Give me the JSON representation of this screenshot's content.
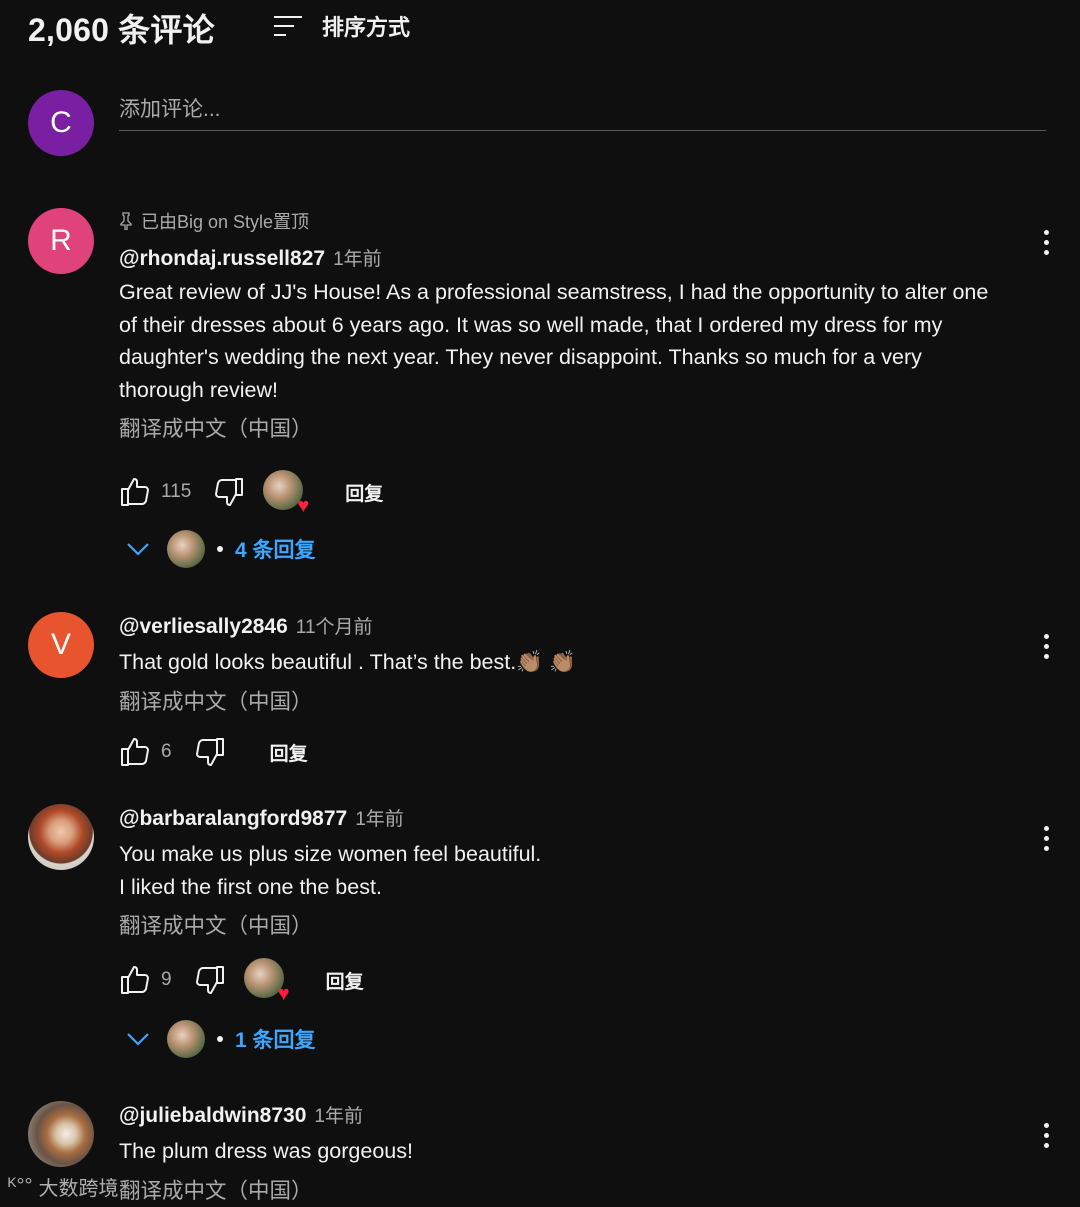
{
  "header": {
    "count": "2,060 条评论",
    "sort_label": "排序方式"
  },
  "add_comment": {
    "avatar_letter": "C",
    "placeholder": "添加评论...",
    "avatar_color": "#7b1fa2"
  },
  "comments": [
    {
      "pinned": "已由Big on Style置顶",
      "avatar_letter": "R",
      "avatar_color": "#e0427a",
      "author": "@rhondaj.russell827",
      "time": "1年前",
      "text": "Great review of JJ's House! As a professional seamstress, I had the opportunity to alter one of their dresses about 6 years ago. It was so well made, that I ordered my dress for my daughter's wedding the next year. They never disappoint. Thanks so much for a very thorough review!",
      "translate": "翻译成中文（中国）",
      "likes": "115",
      "reply": "回复",
      "replies": "4 条回复"
    },
    {
      "avatar_letter": "V",
      "avatar_color": "#e8542e",
      "author": "@verliesally2846",
      "time": "11个月前",
      "text": "That gold looks beautiful . That’s the best.👏🏽 👏🏽",
      "translate": "翻译成中文（中国）",
      "likes": "6",
      "reply": "回复"
    },
    {
      "author": "@barbaralangford9877",
      "time": "1年前",
      "text": "You make us plus size women feel beautiful.\nI liked the first one the best.",
      "translate": "翻译成中文（中国）",
      "likes": "9",
      "reply": "回复",
      "replies": "1 条回复"
    },
    {
      "author": "@juliebaldwin8730",
      "time": "1年前",
      "text": "The plum dress was gorgeous!",
      "translate": "翻译成中文（中国）"
    }
  ],
  "watermark": "大数跨境",
  "colors": {
    "background": "#0f0f0f",
    "link_blue": "#3ea6ff",
    "heart": "#ff1f3d"
  }
}
